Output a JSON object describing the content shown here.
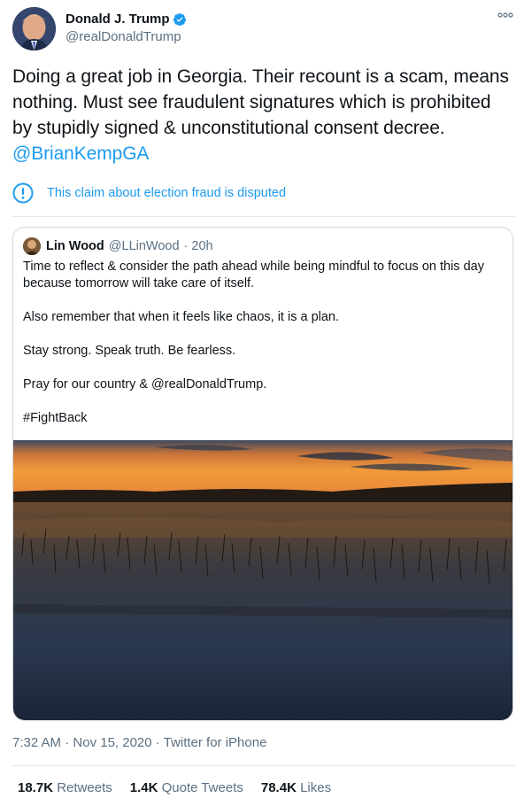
{
  "tweet": {
    "author_name": "Donald J. Trump",
    "author_handle": "@realDonaldTrump",
    "text_main": "Doing a great job in Georgia. Their recount is a scam, means nothing. Must see fraudulent signatures which is prohibited by stupidly signed & unconstitutional consent decree. ",
    "text_mention": "@BrianKempGA",
    "notice": "This claim about election fraud is disputed",
    "time": "7:32 AM",
    "date": "Nov 15, 2020",
    "source": "Twitter for iPhone",
    "sep": "·",
    "icons": {
      "verified": "verified-badge-icon",
      "more": "more-options-icon",
      "notice": "exclamation-circle-icon"
    },
    "colors": {
      "accent": "#1d9bf0",
      "muted": "#5b7083",
      "text": "#0f1419"
    }
  },
  "quote": {
    "name": "Lin Wood",
    "handle": "@LLinWood",
    "time": "· 20h",
    "paragraphs": [
      "Time to reflect & consider the path ahead while being mindful to focus on this day because tomorrow will take care of itself.",
      "Also remember that when it feels like chaos, it is a plan.",
      "Stay strong. Speak truth. Be fearless.",
      "Pray for our country & @realDonaldTrump.",
      "#FightBack"
    ]
  },
  "stats": {
    "retweets_count": "18.7K",
    "retweets_label": "Retweets",
    "quotes_count": "1.4K",
    "quotes_label": "Quote Tweets",
    "likes_count": "78.4K",
    "likes_label": "Likes"
  }
}
